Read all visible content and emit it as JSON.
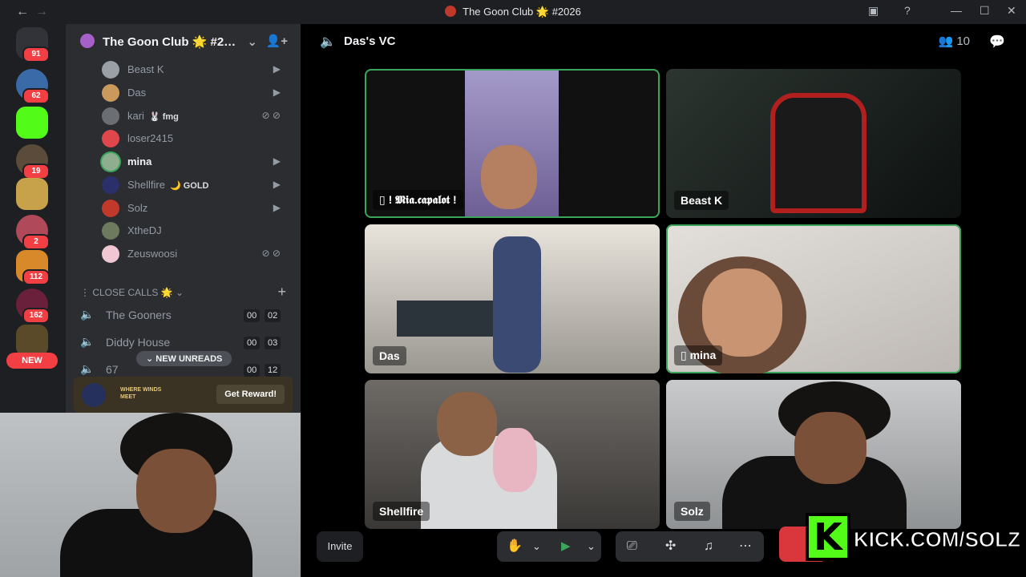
{
  "window": {
    "title": "The Goon Club 🌟 #2026",
    "back_glyph": "←",
    "forward_glyph": "→",
    "controls": [
      "▣",
      "?",
      "—",
      "☐",
      "✕"
    ]
  },
  "rail": {
    "badges": [
      "91",
      "62",
      "19",
      "2",
      "112",
      "162"
    ],
    "new_label": "NEW"
  },
  "sidebar": {
    "server_name": "The Goon Club 🌟 #2…",
    "members": [
      {
        "name": "Beast K",
        "tag": "",
        "color": "#9aa0a6"
      },
      {
        "name": "Das",
        "tag": "",
        "color": "#c99a5b"
      },
      {
        "name": "kari",
        "tag": "🐰 fmg",
        "color": "#6b6f74"
      },
      {
        "name": "loser2415",
        "tag": "",
        "color": "#e0474c"
      },
      {
        "name": "mina",
        "tag": "",
        "color": "#8fae8f"
      },
      {
        "name": "Shellfire",
        "tag": "🌙 GOLD",
        "color": "#2b2f6a"
      },
      {
        "name": "Solz",
        "tag": "",
        "color": "#c0392b"
      },
      {
        "name": "XtheDJ",
        "tag": "",
        "color": "#6d7a5e"
      },
      {
        "name": "Zeuswoosi",
        "tag": "",
        "color": "#f0c7d2"
      }
    ],
    "category": "⋮ CLOSE CALLS 🌟 ⌄",
    "voice_channels": [
      {
        "name": "The Gooners",
        "a": "00",
        "b": "02"
      },
      {
        "name": "Diddy House",
        "a": "00",
        "b": "03"
      },
      {
        "name": "67",
        "a": "00",
        "b": "12"
      }
    ],
    "new_unreads": "⌄  NEW UNREADS",
    "promo": {
      "text": "WHERE WINDS MEET",
      "button": "Get Reward!"
    }
  },
  "call": {
    "channel": "Das's VC",
    "participant_count": "10",
    "tiles": [
      {
        "label": "▯ ! 𝕸𝖎𝖆.𝖈𝖆𝖕𝖆𝖑𝖔𝖙 !",
        "speaking": true
      },
      {
        "label": "Beast K",
        "speaking": false
      },
      {
        "label": "Das",
        "speaking": false
      },
      {
        "label": "▯ mina",
        "speaking": true
      },
      {
        "label": "Shellfire",
        "speaking": false
      },
      {
        "label": "Solz",
        "speaking": false
      }
    ],
    "controls": {
      "invite": "Invite",
      "mic_icon": "✋",
      "chev": "⌄",
      "camera_icon": "▶",
      "screen_icon": "⎚",
      "activities_icon": "✣",
      "soundboard_icon": "♫",
      "more_icon": "⋯"
    }
  },
  "overlay": {
    "kick_letter": "K",
    "kick_text": "KICK.COM/SOLZ"
  }
}
